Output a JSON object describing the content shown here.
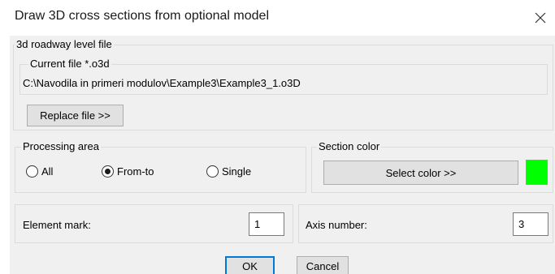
{
  "window": {
    "title": "Draw 3D cross sections from optional model"
  },
  "roadway": {
    "legend": "3d roadway level file",
    "current_file_legend": "Current file *.o3d",
    "current_file_path": "C:\\Navodila in primeri modulov\\Example3\\Example3_1.o3D",
    "replace_button": "Replace file >>"
  },
  "processing": {
    "legend": "Processing area",
    "options": [
      {
        "label": "All",
        "selected": false
      },
      {
        "label": "From-to",
        "selected": true
      },
      {
        "label": "Single",
        "selected": false
      }
    ]
  },
  "section_color": {
    "legend": "Section color",
    "button": "Select color >>",
    "swatch_color": "#00ff00"
  },
  "element_mark": {
    "label": "Element mark:",
    "value": "1"
  },
  "axis_number": {
    "label": "Axis number:",
    "value": "3"
  },
  "buttons": {
    "ok": "OK",
    "cancel": "Cancel"
  }
}
